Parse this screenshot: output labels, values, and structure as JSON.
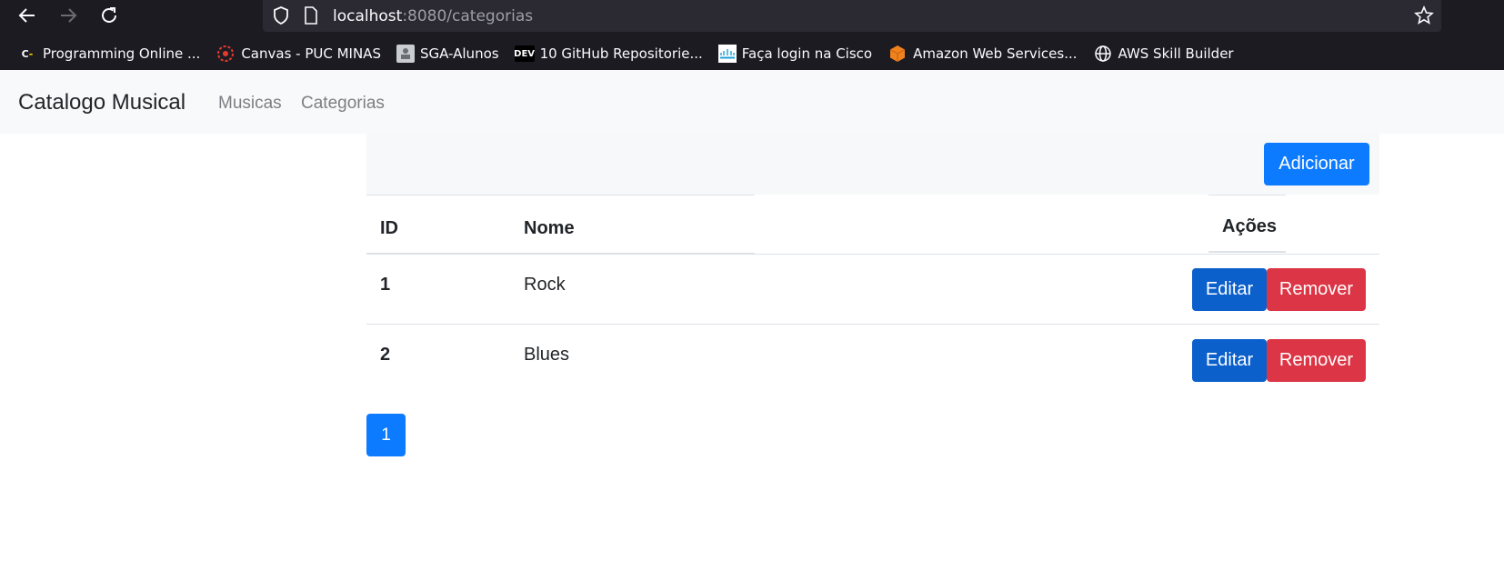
{
  "browser": {
    "url_host": "localhost",
    "url_path": ":8080/categorias",
    "bookmarks": [
      {
        "label": "Programming Online ...",
        "icon": "c-minus-icon",
        "color": "#ffd400"
      },
      {
        "label": "Canvas - PUC MINAS",
        "icon": "canvas-icon",
        "color": "#e23b2e"
      },
      {
        "label": "SGA-Alunos",
        "icon": "sga-icon",
        "color": "#9aa0a6"
      },
      {
        "label": "10 GitHub Repositorie...",
        "icon": "dev-icon",
        "color": "#000000"
      },
      {
        "label": "Faça login na Cisco",
        "icon": "cisco-icon",
        "color": "#1ba0d7"
      },
      {
        "label": "Amazon Web Services...",
        "icon": "aws-cube-icon",
        "color": "#f0821e"
      },
      {
        "label": "AWS Skill Builder",
        "icon": "globe-icon",
        "color": "#fbfbfe"
      }
    ]
  },
  "navbar": {
    "brand": "Catalogo Musical",
    "links": [
      "Musicas",
      "Categorias"
    ]
  },
  "toolbar": {
    "add_label": "Adicionar"
  },
  "table": {
    "headers": {
      "id": "ID",
      "name": "Nome",
      "actions": "Ações"
    },
    "rows": [
      {
        "id": "1",
        "name": "Rock",
        "edit": "Editar",
        "remove": "Remover"
      },
      {
        "id": "2",
        "name": "Blues",
        "edit": "Editar",
        "remove": "Remover"
      }
    ]
  },
  "pagination": {
    "current_page": "1"
  }
}
